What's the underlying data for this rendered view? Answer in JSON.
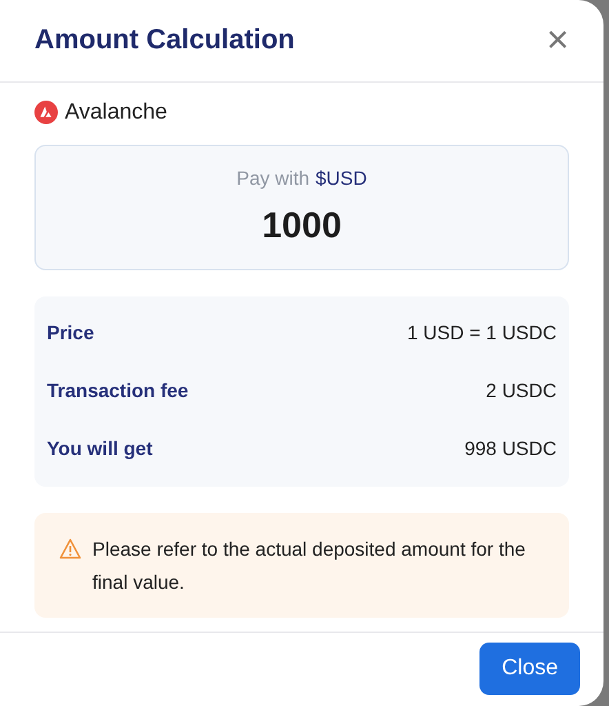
{
  "dialog": {
    "title": "Amount Calculation",
    "close_icon": "×"
  },
  "network": {
    "name": "Avalanche"
  },
  "pay": {
    "label": "Pay with",
    "currency": "$USD",
    "amount": "1000"
  },
  "details": [
    {
      "label": "Price",
      "value": "1 USD = 1 USDC"
    },
    {
      "label": "Transaction fee",
      "value": "2 USDC"
    },
    {
      "label": "You will get",
      "value": "998 USDC"
    }
  ],
  "warning": {
    "text": "Please refer to the actual deposited amount for the final value."
  },
  "buttons": [
    {
      "label": "Close"
    }
  ]
}
